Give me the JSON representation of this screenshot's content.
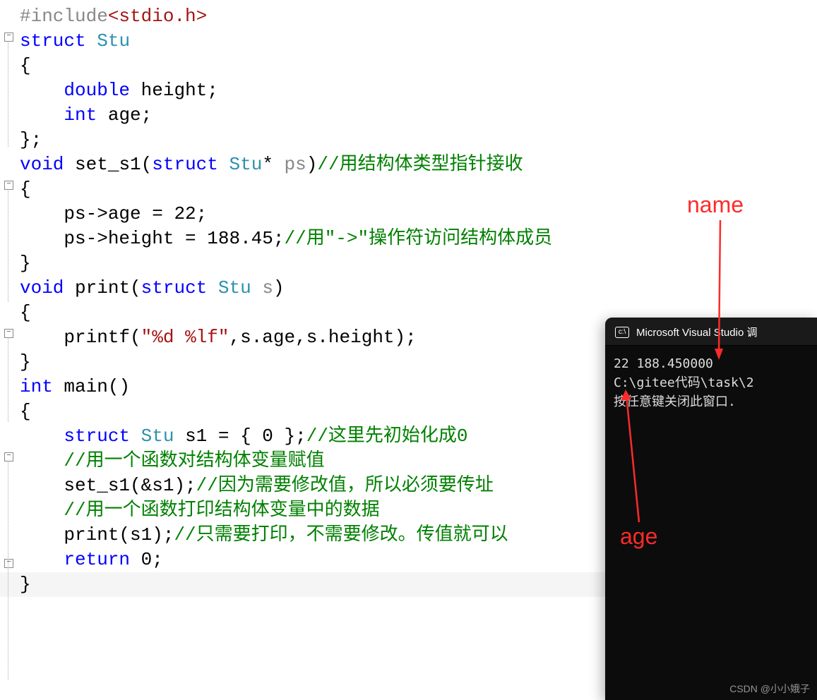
{
  "code": {
    "l1": {
      "pre": "#include",
      "inc": "<stdio.h>"
    },
    "l2": {
      "kw": "struct",
      "name": "Stu"
    },
    "brace_open": "{",
    "brace_close": "}",
    "brace_close_semi": "};",
    "l4": {
      "type": "double",
      "ident": "height",
      "semi": ";"
    },
    "l5": {
      "type": "int",
      "ident": "age",
      "semi": ";"
    },
    "l7": {
      "ret": "void",
      "fn": "set_s1",
      "lp": "(",
      "kw": "struct",
      "type": "Stu",
      "ptr": "*",
      "param": "ps",
      "rp": ")",
      "comm": "//用结构体类型指针接收"
    },
    "l9": {
      "t": "ps->age = 22;"
    },
    "l10": {
      "t": "ps->height = 188.45;",
      "comm": "//用\"->\"操作符访问结构体成员"
    },
    "l12": {
      "ret": "void",
      "fn": "print",
      "lp": "(",
      "kw": "struct",
      "type": "Stu",
      "param": "s",
      "rp": ")"
    },
    "l14": {
      "fn": "printf",
      "lp": "(",
      "str": "\"%d %lf\"",
      "args": ",s.age,s.height);"
    },
    "l16": {
      "ret": "int",
      "fn": "main",
      "parens": "()"
    },
    "l18": {
      "kw": "struct",
      "type": "Stu",
      "rest": "s1 = { 0 };",
      "comm": "//这里先初始化成0"
    },
    "l19": {
      "comm": "//用一个函数对结构体变量赋值"
    },
    "l20": {
      "call": "set_s1(&s1);",
      "comm": "//因为需要修改值，所以必须要传址"
    },
    "l21": {
      "comm": "//用一个函数打印结构体变量中的数据"
    },
    "l22": {
      "call": "print(s1);",
      "comm": "//只需要打印，不需要修改。传值就可以"
    },
    "l23": {
      "kw": "return",
      "val": "0",
      "semi": ";"
    }
  },
  "console": {
    "title": "Microsoft Visual Studio 调",
    "line1": "22 188.450000",
    "line2": "C:\\gitee代码\\task\\2",
    "line3": "按任意键关闭此窗口."
  },
  "anno": {
    "name": "name",
    "age": "age"
  },
  "watermark": "CSDN @小小娥子"
}
